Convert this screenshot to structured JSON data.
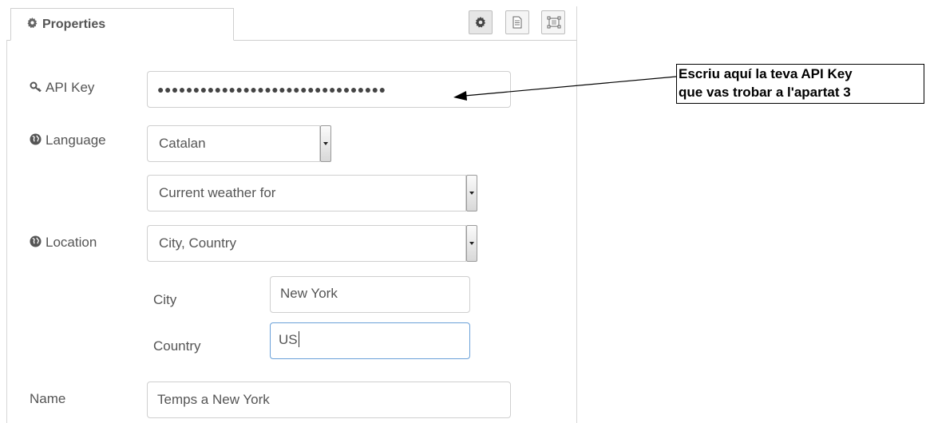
{
  "tab": {
    "label": "Properties",
    "icon": "gear-icon"
  },
  "toolbar": {
    "buttons": [
      {
        "name": "settings-tab-button",
        "icon": "gear-icon"
      },
      {
        "name": "description-tab-button",
        "icon": "document-icon"
      },
      {
        "name": "appearance-tab-button",
        "icon": "frame-icon"
      }
    ]
  },
  "form": {
    "api_key": {
      "label": "API Key",
      "icon": "key-icon",
      "value": "●●●●●●●●●●●●●●●●●●●●●●●●●●●●●●●●"
    },
    "language": {
      "label": "Language",
      "icon": "globe-icon",
      "selected": "Catalan"
    },
    "mode": {
      "selected": "Current weather for"
    },
    "location": {
      "label": "Location",
      "icon": "globe-icon",
      "selected": "City, Country"
    },
    "city": {
      "label": "City",
      "value": "New York"
    },
    "country": {
      "label": "Country",
      "value": "US"
    },
    "name": {
      "label": "Name",
      "value": "Temps a New York"
    }
  },
  "annotation": {
    "line1": "Escriu aquí la teva API Key",
    "line2": "que vas trobar a l'apartat 3"
  }
}
